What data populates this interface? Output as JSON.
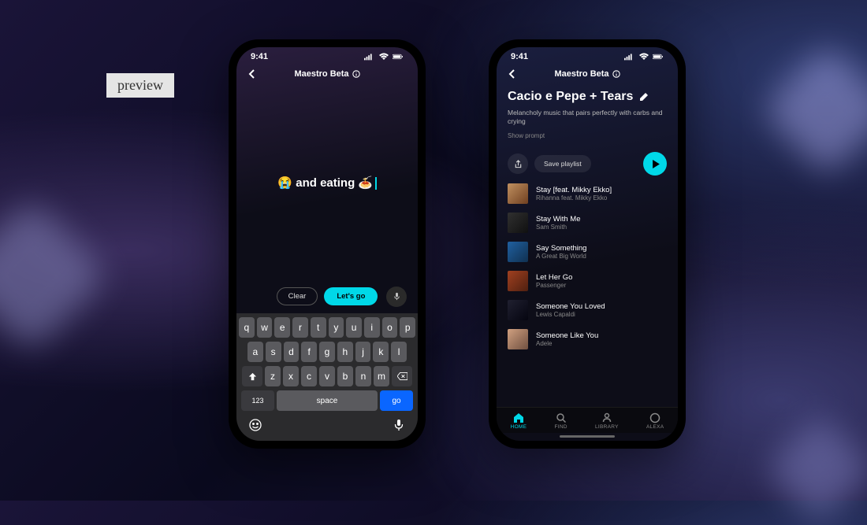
{
  "preview_label": "preview",
  "status": {
    "time": "9:41"
  },
  "header": {
    "title": "Maestro Beta"
  },
  "left": {
    "prompt_prefix_emoji": "😭",
    "prompt_text": " and eating ",
    "prompt_suffix_emoji": "🍝",
    "clear_label": "Clear",
    "go_label": "Let's go",
    "keyboard": {
      "row1": [
        "q",
        "w",
        "e",
        "r",
        "t",
        "y",
        "u",
        "i",
        "o",
        "p"
      ],
      "row2": [
        "a",
        "s",
        "d",
        "f",
        "g",
        "h",
        "j",
        "k",
        "l"
      ],
      "row3": [
        "z",
        "x",
        "c",
        "v",
        "b",
        "n",
        "m"
      ],
      "num_label": "123",
      "space_label": "space",
      "go_label": "go"
    }
  },
  "right": {
    "playlist_title": "Cacio e Pepe + Tears",
    "playlist_desc": "Melancholy music that pairs perfectly with carbs and crying",
    "show_prompt": "Show prompt",
    "save_label": "Save playlist",
    "tracks": [
      {
        "title": "Stay [feat. Mikky Ekko]",
        "artist": "Rihanna feat. Mikky Ekko"
      },
      {
        "title": "Stay With Me",
        "artist": "Sam Smith"
      },
      {
        "title": "Say Something",
        "artist": "A Great Big World"
      },
      {
        "title": "Let Her Go",
        "artist": "Passenger"
      },
      {
        "title": "Someone You Loved",
        "artist": "Lewis Capaldi"
      },
      {
        "title": "Someone Like You",
        "artist": "Adele"
      }
    ],
    "tabs": {
      "home": "HOME",
      "find": "FIND",
      "library": "LIBRARY",
      "alexa": "ALEXA"
    }
  }
}
